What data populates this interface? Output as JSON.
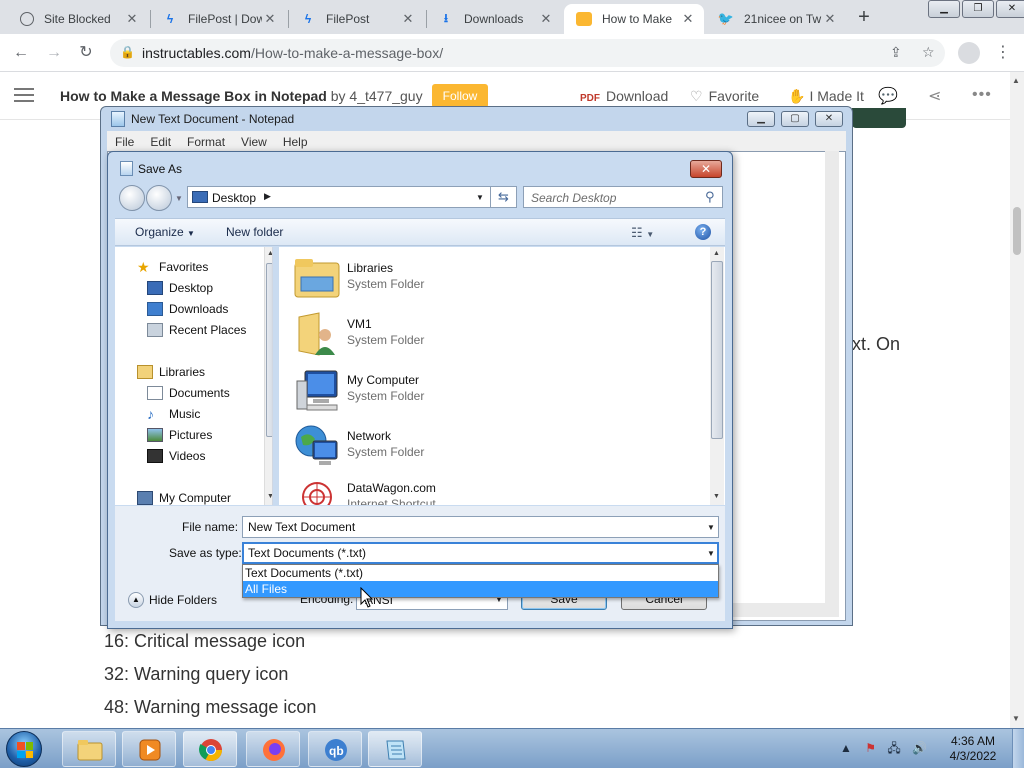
{
  "browser": {
    "tabs": [
      {
        "title": "Site Blocked",
        "icon": "globe-icon",
        "color": "#5f6368"
      },
      {
        "title": "FilePost | Dow",
        "icon": "filepost-bolt-icon",
        "color": "#1a73e8"
      },
      {
        "title": "FilePost",
        "icon": "filepost-bolt-icon",
        "color": "#1a73e8"
      },
      {
        "title": "Downloads",
        "icon": "download-icon",
        "color": "#1a73e8"
      },
      {
        "title": "How to Make",
        "icon": "instructables-robot-icon",
        "color": "#fbb731"
      },
      {
        "title": "21nicee on Tw",
        "icon": "twitter-bird-icon",
        "color": "#1d9bf0"
      }
    ],
    "url_host": "instructables.com",
    "url_path": "/How-to-make-a-message-box/"
  },
  "page": {
    "title": "How to Make a Message Box in Notepad",
    "by": "by 4_t477_guy",
    "follow": "Follow",
    "download": "Download",
    "favorite": "Favorite",
    "made_it": "I Made It",
    "side_text": "xt. On",
    "lines": [
      "16: Critical message icon",
      "32: Warning query icon",
      "48: Warning message icon"
    ]
  },
  "notepad": {
    "title": "New Text Document - Notepad",
    "menu": [
      "File",
      "Edit",
      "Format",
      "View",
      "Help"
    ]
  },
  "dialog": {
    "title": "Save As",
    "path": "Desktop",
    "search_placeholder": "Search Desktop",
    "organize": "Organize",
    "new_folder": "New folder",
    "nav": {
      "favorites": "Favorites",
      "desktop": "Desktop",
      "downloads": "Downloads",
      "recent": "Recent Places",
      "libraries": "Libraries",
      "documents": "Documents",
      "music": "Music",
      "pictures": "Pictures",
      "videos": "Videos",
      "computer": "My Computer"
    },
    "files": [
      {
        "name": "Libraries",
        "type": "System Folder",
        "icon": "libraries-folder-icon"
      },
      {
        "name": "VM1",
        "type": "System Folder",
        "icon": "user-folder-icon"
      },
      {
        "name": "My Computer",
        "type": "System Folder",
        "icon": "computer-icon"
      },
      {
        "name": "Network",
        "type": "System Folder",
        "icon": "network-globe-icon"
      },
      {
        "name": "DataWagon.com",
        "type": "Internet Shortcut",
        "icon": "shortcut-icon"
      }
    ],
    "file_name_label": "File name:",
    "file_name_value": "New Text Document",
    "save_type_label": "Save as type:",
    "save_type_value": "Text Documents (*.txt)",
    "type_options": [
      "Text Documents (*.txt)",
      "All Files"
    ],
    "selected_option": "All Files",
    "hide_folders": "Hide Folders",
    "encoding_label": "Encoding:",
    "encoding_value": "ANSI",
    "save": "Save",
    "cancel": "Cancel"
  },
  "taskbar": {
    "time": "4:36 AM",
    "date": "4/3/2022",
    "apps": [
      "file-explorer-icon",
      "media-player-icon",
      "chrome-icon",
      "firefox-icon",
      "qbittorrent-icon",
      "notepad-icon"
    ]
  }
}
